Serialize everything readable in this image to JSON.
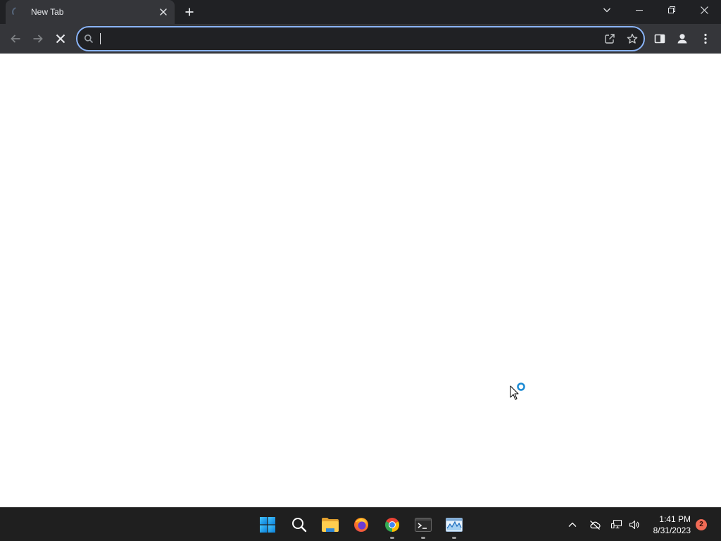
{
  "colors": {
    "tabstrip": "#202124",
    "tab_active": "#35363a",
    "toolbar": "#35363a",
    "omnibox_bg": "#202124",
    "omnibox_focus_ring": "#8ab4f8",
    "icon": "#e8eaed",
    "icon_disabled": "#7f8285",
    "page_bg": "#ffffff",
    "taskbar": "#1f1f1f",
    "badge": "#ef6a55"
  },
  "tab": {
    "title": "New Tab",
    "loading": true,
    "status_icon": "loading-spinner-icon",
    "close_icon": "close-icon"
  },
  "tabstrip": {
    "new_tab_icon": "plus-icon",
    "tab_search_icon": "chevron-down-icon"
  },
  "window_controls": {
    "minimize_icon": "minimize-icon",
    "restore_icon": "restore-icon",
    "close_icon": "close-icon"
  },
  "toolbar": {
    "back": {
      "icon": "arrow-left-icon",
      "enabled": false
    },
    "forward": {
      "icon": "arrow-right-icon",
      "enabled": false
    },
    "stop": {
      "icon": "stop-loading-icon",
      "enabled": true
    },
    "omnibox": {
      "value": "",
      "focused": true,
      "leading_icon": "search-icon",
      "share_icon": "share-icon",
      "bookmark_icon": "star-icon"
    },
    "side_panel_icon": "side-panel-icon",
    "profile_icon": "profile-icon",
    "menu_icon": "more-vert-icon"
  },
  "taskbar": {
    "apps": [
      {
        "icon": "windows-start-icon",
        "running": false
      },
      {
        "icon": "search-icon",
        "running": false
      },
      {
        "icon": "file-explorer-icon",
        "running": false
      },
      {
        "icon": "firefox-icon",
        "running": false
      },
      {
        "icon": "chrome-icon",
        "running": true
      },
      {
        "icon": "terminal-icon",
        "running": true
      },
      {
        "icon": "performance-monitor-icon",
        "running": true
      }
    ],
    "tray": {
      "overflow_icon": "chevron-up-icon",
      "onedrive_icon": "onedrive-offline-icon",
      "network_icon": "network-icon",
      "volume_icon": "volume-icon",
      "clock": {
        "time": "1:41 PM",
        "date": "8/31/2023"
      },
      "notification_count": 2
    }
  },
  "cursor": {
    "icon": "busy-cursor-icon"
  }
}
